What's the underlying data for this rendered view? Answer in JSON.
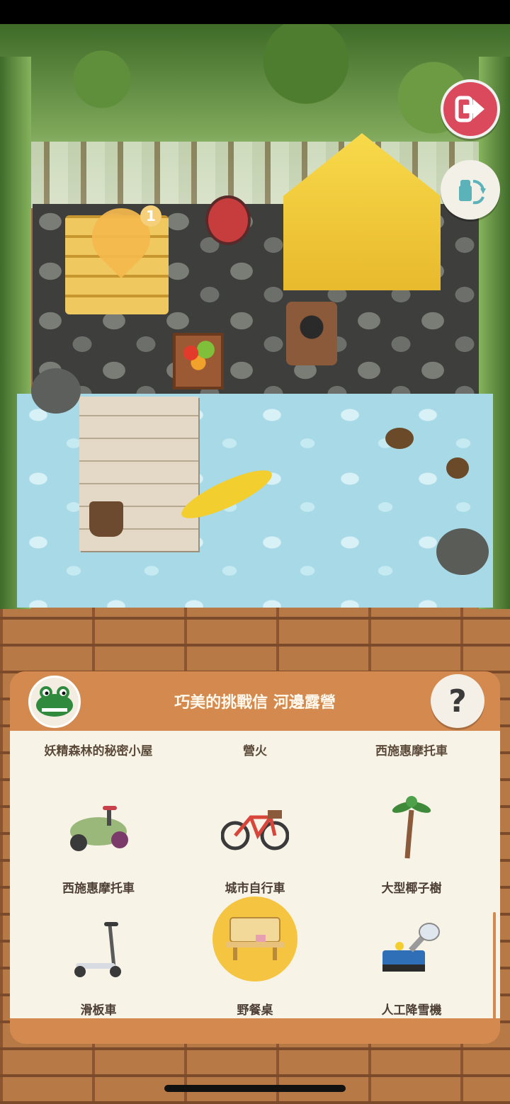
{
  "colors": {
    "panel": "#d48a4f",
    "panel_body": "#f7f3e6",
    "exit_button": "#db4a5c",
    "selected_highlight": "#f5c441"
  },
  "scene": {
    "pin_badge_count": "1",
    "icons": [
      "exit-icon",
      "swap-furniture-icon",
      "camp-location-pin-icon"
    ]
  },
  "panel": {
    "title": "巧美的挑戰信 河邊露營",
    "help_label": "?",
    "avatar_icon": "crocodile-avatar-icon",
    "top_row": [
      "妖精森林的秘密小屋",
      "營火",
      "西施惠摩托車"
    ],
    "items": [
      {
        "label": "西施惠摩托車",
        "icon": "scooter-icon",
        "selected": false
      },
      {
        "label": "城市自行車",
        "icon": "bicycle-icon",
        "selected": false
      },
      {
        "label": "大型椰子樹",
        "icon": "palm-tree-icon",
        "selected": false
      },
      {
        "label": "滑板車",
        "icon": "kick-scooter-icon",
        "selected": false
      },
      {
        "label": "野餐桌",
        "icon": "picnic-table-icon",
        "selected": true
      },
      {
        "label": "人工降雪機",
        "icon": "snow-machine-icon",
        "selected": false
      }
    ]
  }
}
